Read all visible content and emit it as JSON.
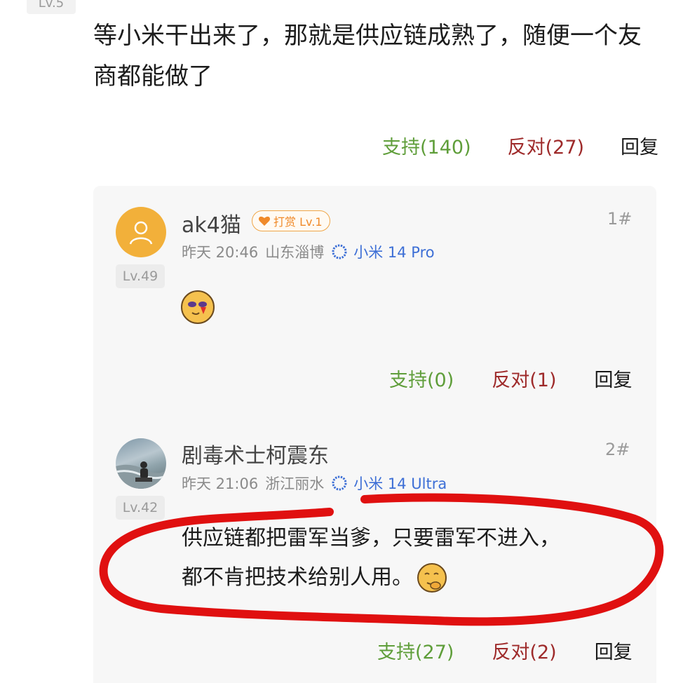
{
  "colors": {
    "support": "#5f9e3a",
    "oppose": "#9e2a2a",
    "device": "#3d6fd6",
    "avatar_bg": "#f2b03a",
    "circle": "#e01010"
  },
  "top": {
    "level": "Lv.5",
    "text": "等小米干出来了，那就是供应链成熟了，随便一个友商都能做了",
    "support": "支持(140)",
    "oppose": "反对(27)",
    "reply": "回复"
  },
  "replies": [
    {
      "username": "ak4猫",
      "badge": "打赏 Lv.1",
      "floor": "1#",
      "time": "昨天 20:46",
      "location": "山东淄博",
      "device": "小米 14 Pro",
      "level": "Lv.49",
      "support": "支持(0)",
      "oppose": "反对(1)",
      "reply": "回复",
      "avatar_icon": "person-icon"
    },
    {
      "username": "剧毒术士柯震东",
      "floor": "2#",
      "time": "昨天 21:06",
      "location": "浙江丽水",
      "device": "小米 14 Ultra",
      "level": "Lv.42",
      "text_line1": "供应链都把雷军当爹，只要雷军不进入，",
      "text_line2": "都不肯把技术给别人用。",
      "support": "支持(27)",
      "oppose": "反对(2)",
      "reply": "回复"
    }
  ]
}
